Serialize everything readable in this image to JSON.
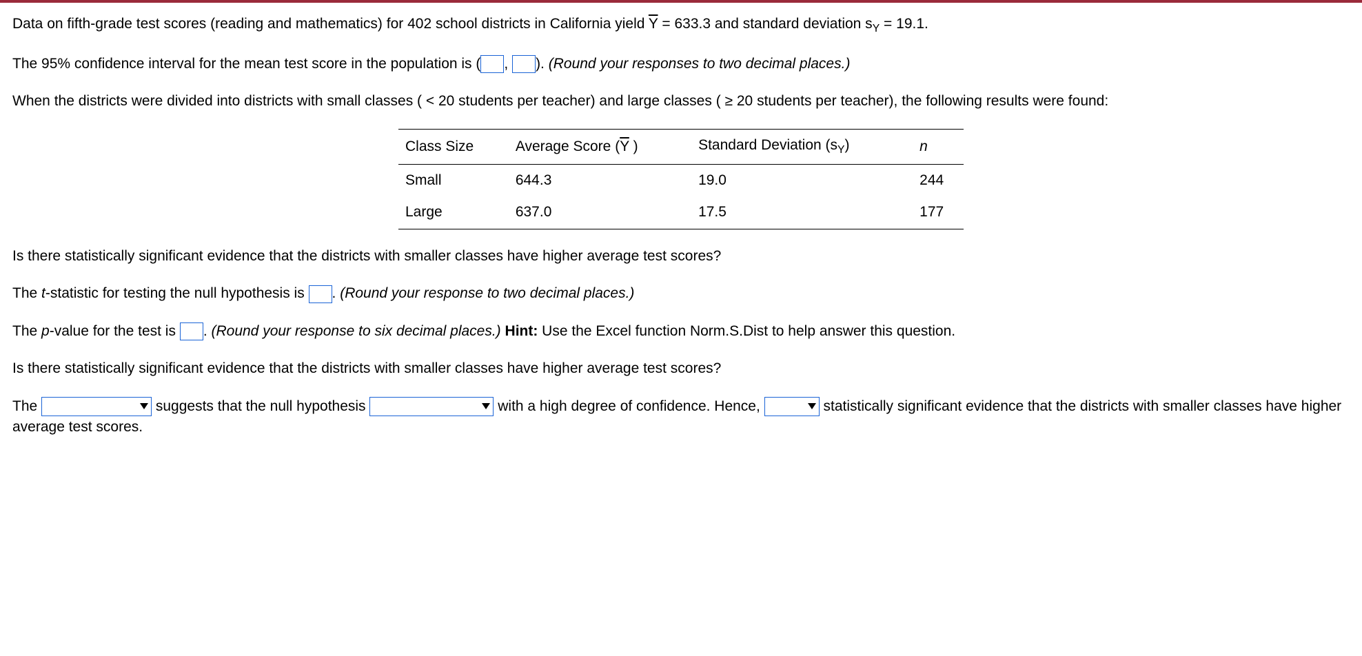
{
  "intro": {
    "text1": "Data on fifth-grade test scores (reading and mathematics) for 402 school districts in California yield ",
    "ybar": "Y",
    "eq1": " = 633.3 and standard deviation s",
    "sub1": "Y",
    "eq2": " = 19.1."
  },
  "ci": {
    "text1": "The 95% confidence interval for the mean test score in the population is (",
    "comma": ", ",
    "text2": "). ",
    "hint": "(Round your responses to two decimal places.)"
  },
  "split": {
    "text": "When the districts were divided into districts with small classes ( < 20 students per teacher) and large classes ( ≥ 20 students per teacher), the following results were found:"
  },
  "table": {
    "headers": {
      "c1": "Class Size",
      "c2a": "Average Score (",
      "c2b": "Y",
      "c2c": " )",
      "c3a": "Standard Deviation (s",
      "c3sub": "Y",
      "c3b": ")",
      "c4": "n"
    },
    "rows": [
      {
        "c1": "Small",
        "c2": "644.3",
        "c3": "19.0",
        "c4": "244"
      },
      {
        "c1": "Large",
        "c2": "637.0",
        "c3": "17.5",
        "c4": "177"
      }
    ]
  },
  "q1": "Is there statistically significant evidence that the districts with smaller classes have higher average test scores?",
  "tstat": {
    "text1": "The ",
    "tital": "t",
    "text2": "-statistic for testing the null hypothesis is ",
    "text3": ". ",
    "hint": "(Round your response to two decimal places.)"
  },
  "pval": {
    "text1": "The ",
    "pital": "p",
    "text2": "-value for the test is ",
    "text3": ". ",
    "hint": "(Round your response to six decimal places.)",
    "hint2a": " Hint:",
    "hint2b": " Use the Excel function Norm.S.Dist to help answer this question."
  },
  "q2": "Is there statistically significant evidence that the districts with smaller classes have higher average test scores?",
  "conclusion": {
    "t1": "The ",
    "t2": " suggests that the null hypothesis ",
    "t3": " with a high degree of confidence. Hence, ",
    "t4": " statistically significant evidence that the districts with smaller classes have higher average test scores."
  }
}
